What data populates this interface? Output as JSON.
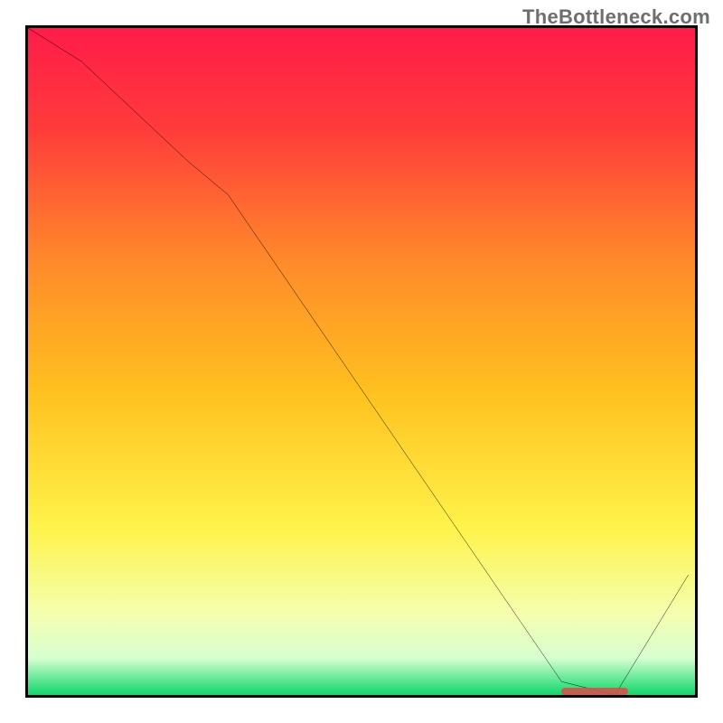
{
  "watermark": "TheBottleneck.com",
  "colors": {
    "border": "#000000",
    "curve": "#000000",
    "marker": "#d6524b",
    "gradient_stops": [
      {
        "offset": 0.0,
        "color": "#ff1c49"
      },
      {
        "offset": 0.15,
        "color": "#ff3b3b"
      },
      {
        "offset": 0.35,
        "color": "#ff8a2a"
      },
      {
        "offset": 0.55,
        "color": "#ffc21f"
      },
      {
        "offset": 0.75,
        "color": "#fff34b"
      },
      {
        "offset": 0.88,
        "color": "#f4ffb0"
      },
      {
        "offset": 0.945,
        "color": "#d7ffd0"
      },
      {
        "offset": 0.975,
        "color": "#66e998"
      },
      {
        "offset": 1.0,
        "color": "#12d66b"
      }
    ]
  },
  "chart_data": {
    "type": "line",
    "title": "",
    "xlabel": "",
    "ylabel": "",
    "xlim": [
      0,
      100
    ],
    "ylim": [
      0,
      100
    ],
    "grid": false,
    "series": [
      {
        "name": "bottleneck-curve",
        "x": [
          0,
          8,
          24,
          30,
          80,
          88,
          99
        ],
        "values": [
          100,
          95,
          80,
          75,
          2,
          0,
          18
        ]
      }
    ],
    "annotations": [
      {
        "name": "plateau-marker",
        "x_start": 80,
        "x_end": 90,
        "y": 0.5
      }
    ]
  }
}
